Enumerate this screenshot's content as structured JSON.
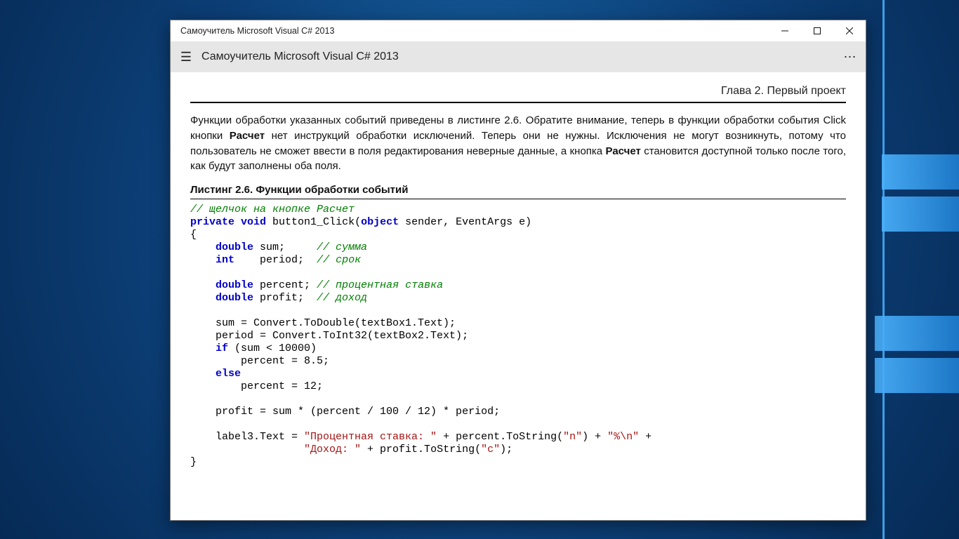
{
  "window_title": "Самоучитель Microsoft Visual C# 2013",
  "toolbar_title": "Самоучитель Microsoft Visual C# 2013",
  "chapter_heading": "Глава 2. Первый проект",
  "paragraph": {
    "t1": "Функции обработки указанных событий приведены в листинге 2.6. Обратите внимание, теперь в функции обработки события Click кнопки ",
    "b1": "Расчет",
    "t2": " нет инструкций обработки исключений. Теперь они не нужны. Исключения не могут возникнуть, потому что пользователь не сможет ввести в поля редактирования неверные данные, а кнопка ",
    "b2": "Расчет",
    "t3": " становится доступной только после того, как будут заполнены оба поля."
  },
  "listing_title": "Листинг 2.6. Функции обработки событий",
  "code": {
    "c01": "// щелчок на кнопке Расчет",
    "k01": "private",
    "k02": "void",
    "sig": " button1_Click(",
    "k03": "object",
    "sig2": " sender, EventArgs e)",
    "brace_open": "{",
    "k04": "double",
    "v01": " sum;     ",
    "c02": "// сумма",
    "k05": "int",
    "v02": "    period;  ",
    "c03": "// срок",
    "k06": "double",
    "v03": " percent; ",
    "c04": "// процентная ставка",
    "k07": "double",
    "v04": " profit;  ",
    "c05": "// доход",
    "l01": "    sum = Convert.ToDouble(textBox1.Text);",
    "l02": "    period = Convert.ToInt32(textBox2.Text);",
    "k08": "if",
    "l03": " (sum < 10000)",
    "l04": "        percent = 8.5;",
    "k09": "else",
    "l05": "        percent = 12;",
    "l06": "    profit = sum * (percent / 100 / 12) * period;",
    "l07a": "    label3.Text = ",
    "s01": "\"Процентная ставка: \"",
    "l07b": " + percent.ToString(",
    "s02": "\"n\"",
    "l07c": ") + ",
    "s03": "\"%\\n\"",
    "l07d": " +",
    "l08a": "                  ",
    "s04": "\"Доход: \"",
    "l08b": " + profit.ToString(",
    "s05": "\"c\"",
    "l08c": ");",
    "brace_close": "}"
  }
}
